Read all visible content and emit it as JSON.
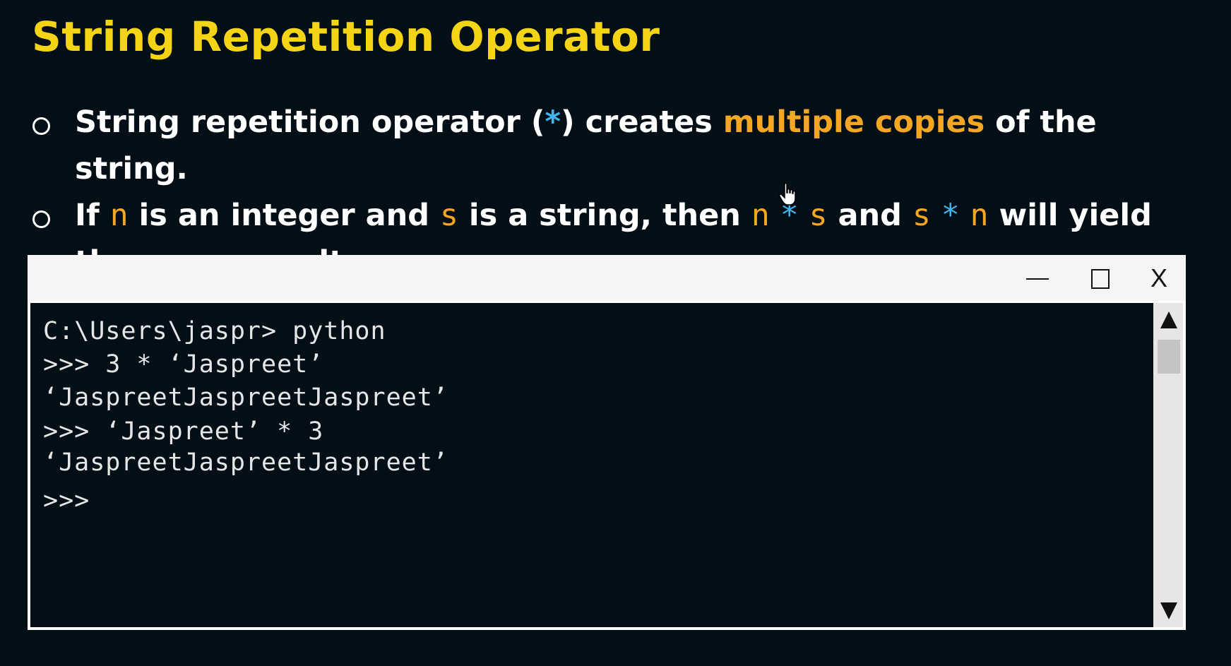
{
  "slide": {
    "title": "String Repetition Operator",
    "bullet1": {
      "part1": "String repetition operator (",
      "op": "*",
      "part2": ") creates ",
      "highlight": "multiple copies",
      "part3": " of the string."
    },
    "bullet2": {
      "part1": "If ",
      "n": "n",
      "part2": " is an integer and ",
      "s": "s",
      "part3": " is a string, then ",
      "expr1_a": "n",
      "expr1_op": "*",
      "expr1_b": "s",
      "part4": " and ",
      "expr2_a": "s",
      "expr2_op": "*",
      "expr2_b": "n",
      "part5": " will yield the same result."
    }
  },
  "terminal": {
    "controls": {
      "close": "X"
    },
    "lines": [
      "C:\\Users\\jaspr> python",
      ">>> 3 * ‘Jaspreet’",
      "‘JaspreetJaspreetJaspreet’",
      ">>> ‘Jaspreet’ * 3",
      "‘JaspreetJaspreetJaspreet’",
      ">>>"
    ]
  },
  "colors": {
    "title": "#f5d416",
    "highlight": "#f5a623",
    "operator": "#3fb6f2",
    "background": "#030f16"
  }
}
